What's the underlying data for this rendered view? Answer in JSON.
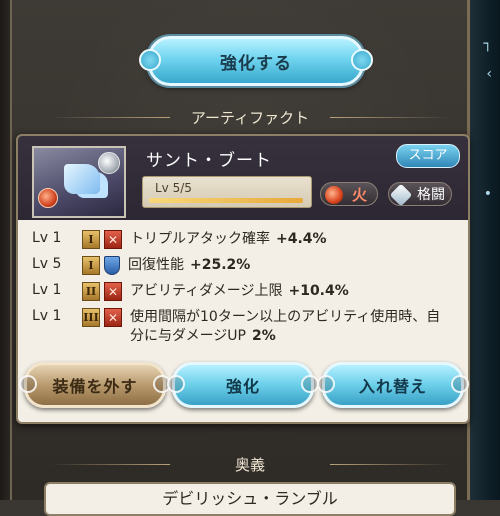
{
  "top_button": {
    "label": "強化する"
  },
  "artifact_section": {
    "title": "アーティファクト"
  },
  "artifact": {
    "name": "サント・ブート",
    "score_label": "スコア",
    "level": "Lv 5/5",
    "level_progress": 1.0,
    "element": "火",
    "weapon_type": "格闘"
  },
  "skills": [
    {
      "level": "Lv 1",
      "rank": "I",
      "icon": "attack-icon",
      "text": "トリプルアタック確率",
      "value": "+4.4%"
    },
    {
      "level": "Lv 5",
      "rank": "I",
      "icon": "shield-icon",
      "text": "回復性能",
      "value": "+25.2%"
    },
    {
      "level": "Lv 1",
      "rank": "II",
      "icon": "attack-icon",
      "text": "アビリティダメージ上限",
      "value": "+10.4%"
    },
    {
      "level": "Lv 1",
      "rank": "III",
      "icon": "attack-icon",
      "text": "使用間隔が10ターン以上のアビリティ使用時、自分に与ダメージUP",
      "value": "2%"
    }
  ],
  "buttons": {
    "unequip": "装備を外す",
    "enhance": "強化",
    "swap": "入れ替え"
  },
  "ougi_section": {
    "title": "奥義"
  },
  "ougi": {
    "name": "デビリッシュ・ランブル"
  },
  "colors": {
    "accent_blue": "#6fd4ef",
    "fire": "#d8431c",
    "panel": "#f3efe6"
  }
}
